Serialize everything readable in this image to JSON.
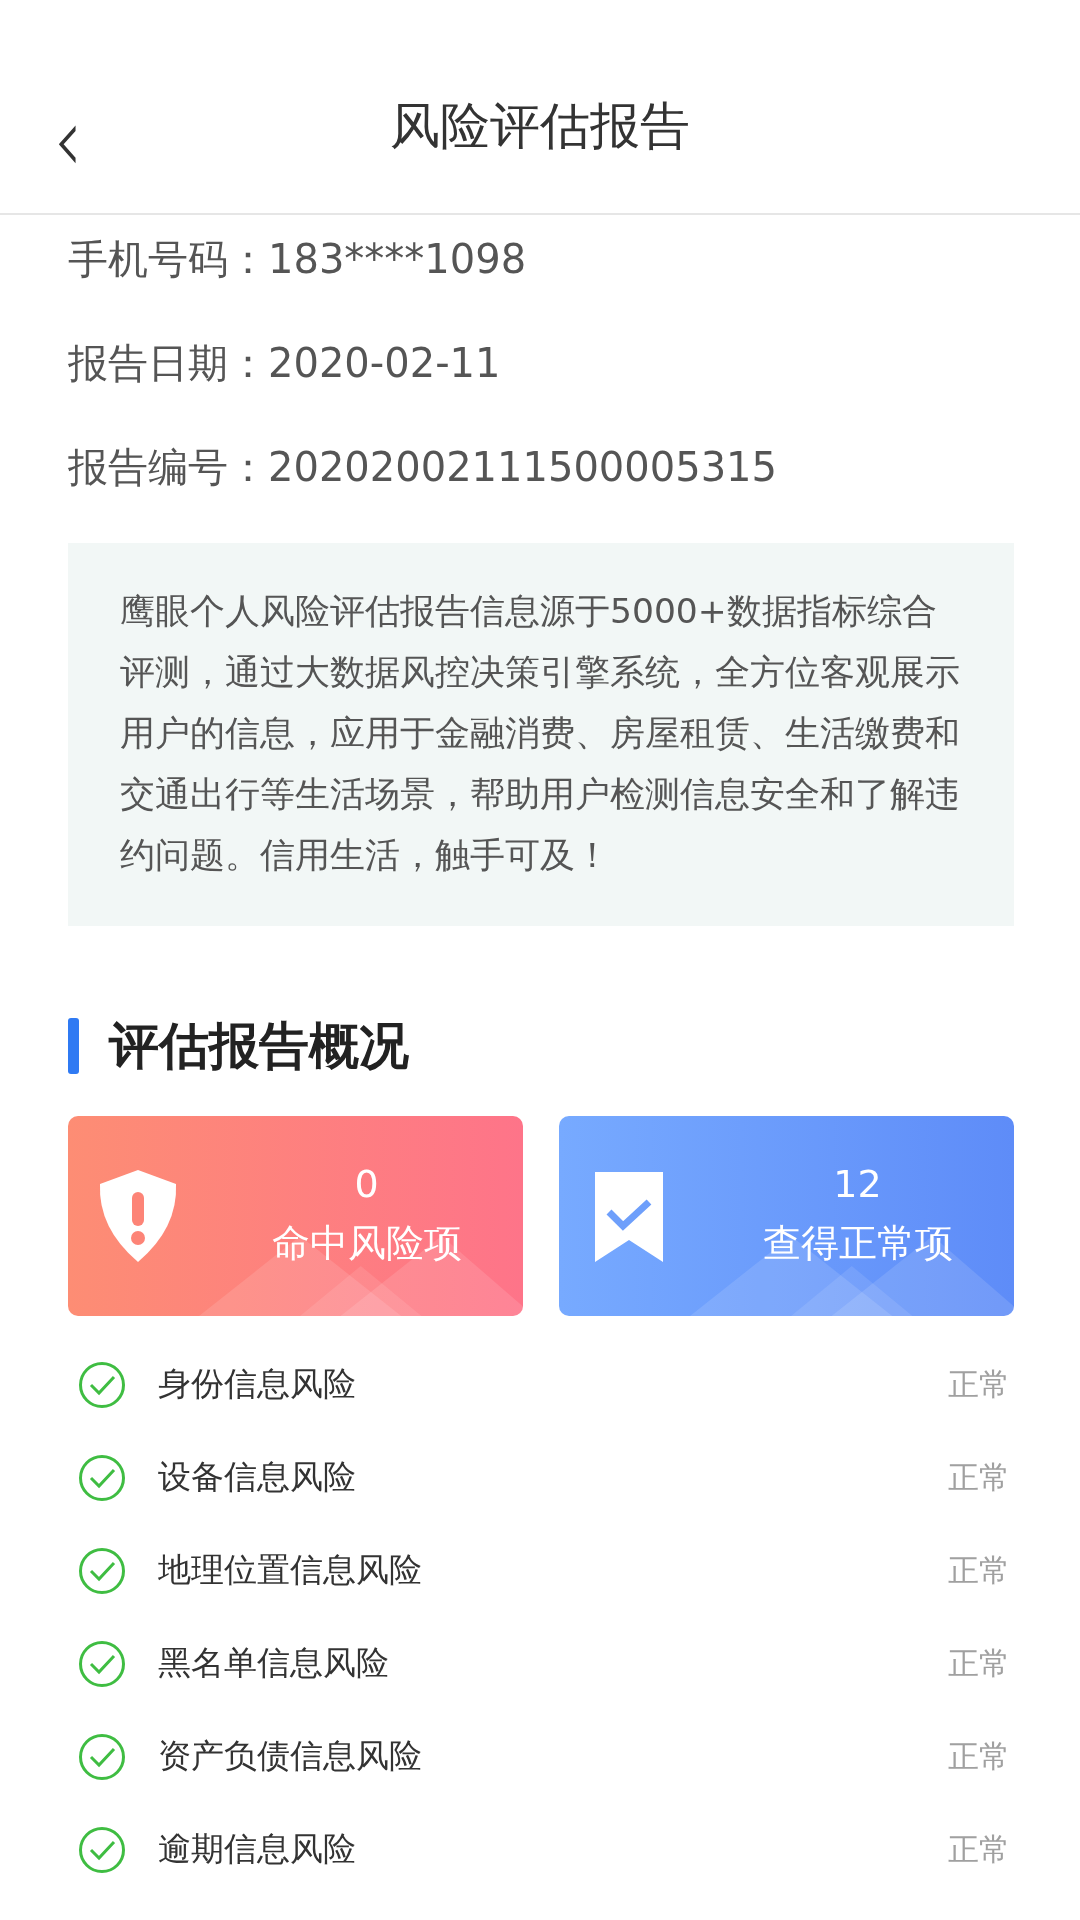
{
  "header": {
    "back": "‹",
    "title": "风险评估报告"
  },
  "info": [
    {
      "label": "手机号码：",
      "value": "183****1098"
    },
    {
      "label": "报告日期：",
      "value": "2020-02-11"
    },
    {
      "label": "报告编号：",
      "value": "20202002111500005315"
    }
  ],
  "notice": "鹰眼个人风险评估报告信息源于5000+数据指标综合评测，通过大数据风控决策引擎系统，全方位客观展示用户的信息，应用于金融消费、房屋租赁、生活缴费和交通出行等生活场景，帮助用户检测信息安全和了解违约问题。信用生活，触手可及！",
  "section_title": "评估报告概况",
  "cards": [
    {
      "kind": "risk",
      "count": "0",
      "label": "命中风险项"
    },
    {
      "kind": "normal",
      "count": "12",
      "label": "查得正常项"
    }
  ],
  "items": [
    {
      "name": "身份信息风险",
      "status": "正常"
    },
    {
      "name": "设备信息风险",
      "status": "正常"
    },
    {
      "name": "地理位置信息风险",
      "status": "正常"
    },
    {
      "name": "黑名单信息风险",
      "status": "正常"
    },
    {
      "name": "资产负债信息风险",
      "status": "正常"
    },
    {
      "name": "逾期信息风险",
      "status": "正常"
    }
  ]
}
